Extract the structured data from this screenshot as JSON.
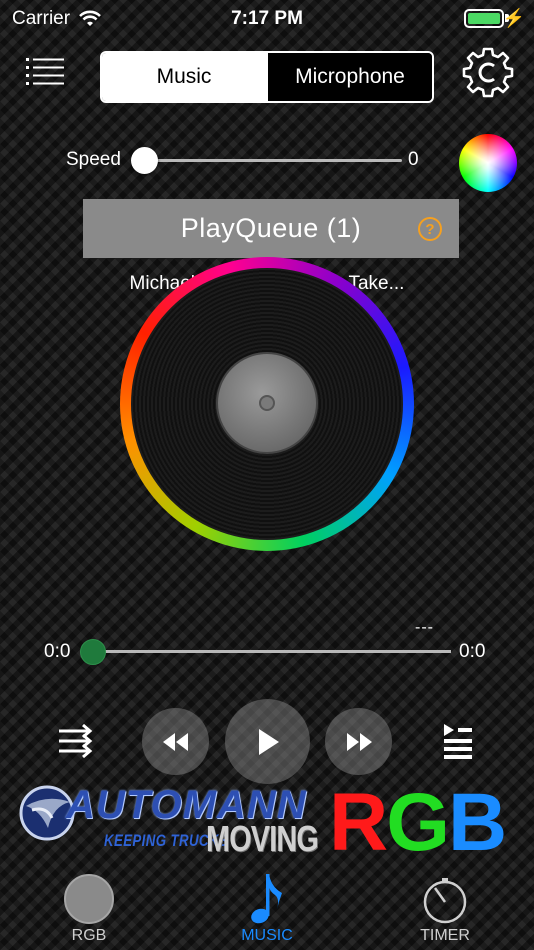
{
  "status": {
    "carrier": "Carrier",
    "time": "7:17 PM"
  },
  "segments": {
    "music": "Music",
    "microphone": "Microphone"
  },
  "speed": {
    "label": "Speed",
    "value": "0"
  },
  "playqueue": {
    "title": "PlayQueue  (1)",
    "help": "?"
  },
  "song": "Michael Learns To Rock - Take...",
  "progress": {
    "elapsed": "0:0",
    "total": "0:0",
    "dashes": "---",
    "fraction": 0
  },
  "branding": {
    "brand": "AUTOMANN",
    "tagline": "KEEPING TRUCKS",
    "moving": "MOVING",
    "rgb": [
      "R",
      "G",
      "B"
    ]
  },
  "tabs": [
    {
      "label": "RGB",
      "selected": false
    },
    {
      "label": "MUSIC",
      "selected": true
    },
    {
      "label": "TIMER",
      "selected": false
    }
  ],
  "colors": {
    "accent": "#1a8bff",
    "help": "#f5a020",
    "progress_thumb": "#1f7a3c",
    "rgb_r": "#ff1a1a",
    "rgb_g": "#22dd22",
    "rgb_b": "#1a8cff"
  },
  "icons": {
    "menu": "menu-icon",
    "settings": "gear-icon",
    "shuffle": "shuffle-icon",
    "prev": "rewind-icon",
    "play": "play-icon",
    "next": "fast-forward-icon",
    "queue": "playlist-icon",
    "timer": "timer-icon",
    "music": "music-note-icon"
  }
}
